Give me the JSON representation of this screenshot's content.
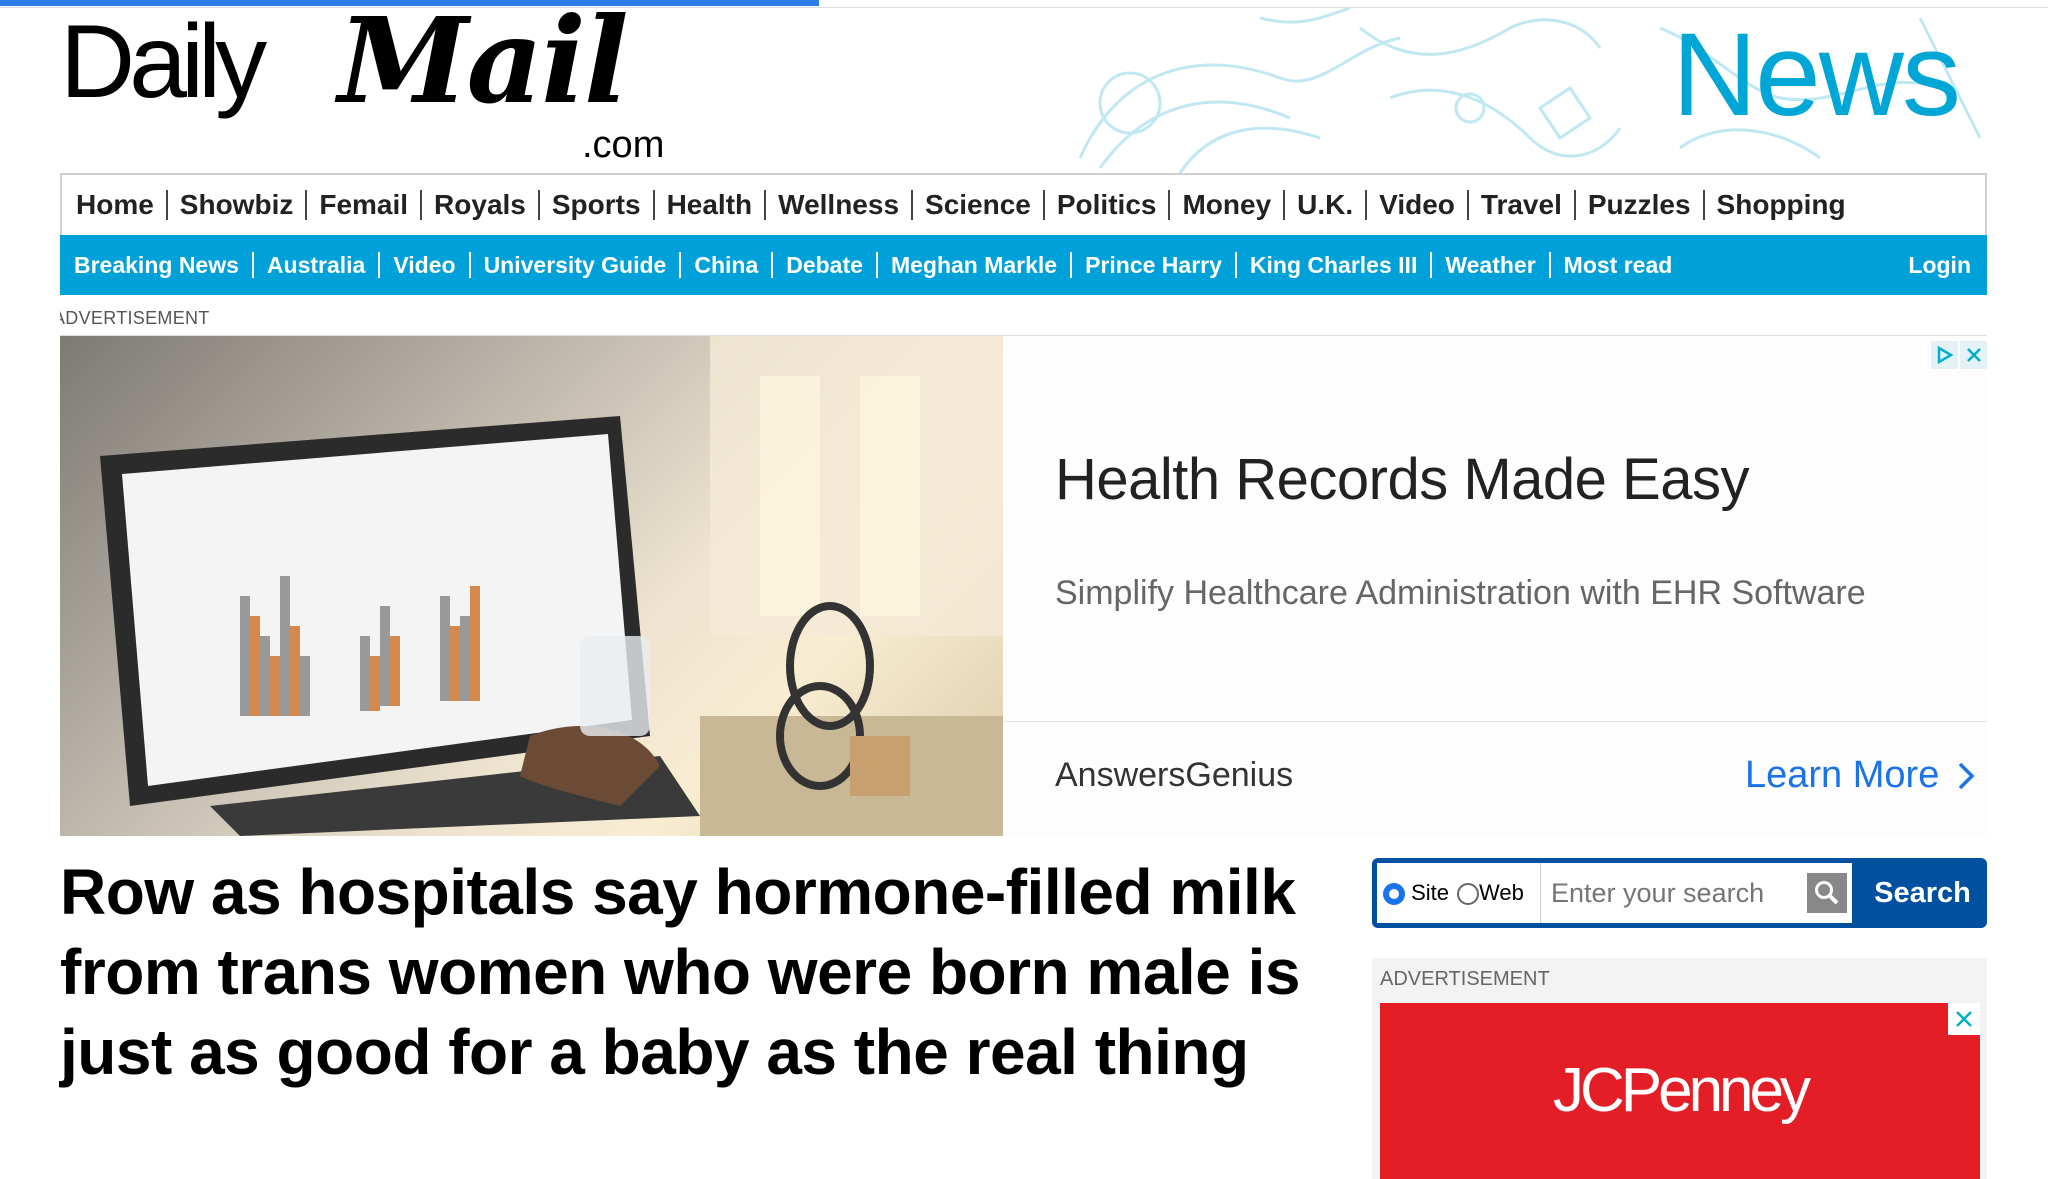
{
  "page": {
    "load_progress": 0.4
  },
  "masthead": {
    "logo_daily": "Daily",
    "logo_mail": "Mail",
    "logo_dotcom": ".com",
    "channel": "News",
    "channel_color": "#00a6d6"
  },
  "nav_primary": [
    "Home",
    "Showbiz",
    "Femail",
    "Royals",
    "Sports",
    "Health",
    "Wellness",
    "Science",
    "Politics",
    "Money",
    "U.K.",
    "Video",
    "Travel",
    "Puzzles",
    "Shopping"
  ],
  "nav_secondary": {
    "items": [
      "Breaking News",
      "Australia",
      "Video",
      "University Guide",
      "China",
      "Debate",
      "Meghan Markle",
      "Prince Harry",
      "King Charles III",
      "Weather",
      "Most read"
    ],
    "login": "Login",
    "bg_color": "#00a1d8"
  },
  "top_ad": {
    "label": "ADVERTISEMENT",
    "headline": "Health Records Made Easy",
    "description": "Simplify Healthcare Administration with EHR Software",
    "advertiser": "AnswersGenius",
    "cta": "Learn More",
    "cta_color": "#1a73e8",
    "icons": [
      "adchoices-icon",
      "close-icon"
    ]
  },
  "article": {
    "headline": "Row as hospitals say hormone-filled milk from trans women who were born male is just as good for a baby as the real thing"
  },
  "search": {
    "option_site": "Site",
    "option_web": "Web",
    "selected": "Site",
    "placeholder": "Enter your search",
    "button": "Search",
    "bg_color": "#0050a0"
  },
  "side_ad": {
    "label": "ADVERTISEMENT",
    "brand": "JCPenney",
    "brand_color": "#e41e26"
  }
}
